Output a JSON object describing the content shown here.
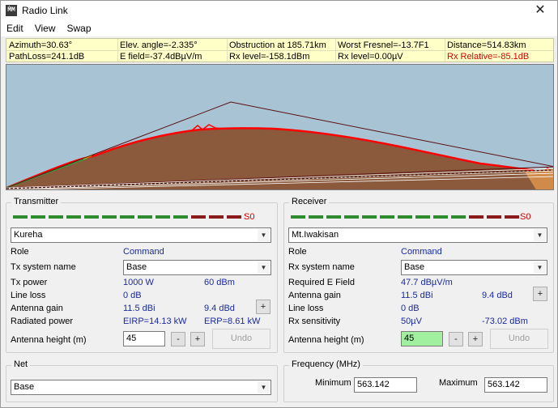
{
  "window": {
    "title": "Radio Link",
    "close_glyph": "✕",
    "icon": "radio-link-app-icon"
  },
  "menu": [
    "Edit",
    "View",
    "Swap"
  ],
  "info": {
    "row1": [
      "Azimuth=30.63°",
      "Elev. angle=-2.335°",
      "Obstruction at 185.71km",
      "Worst Fresnel=-13.7F1",
      "Distance=514.83km"
    ],
    "row2": [
      "PathLoss=241.1dB",
      "E field=-37.4dBµV/m",
      "Rx level=-158.1dBm",
      "Rx level=0.00µV",
      "Rx Relative=-85.1dB"
    ]
  },
  "colors": {
    "sky": "#a8c4d4",
    "terrain": "#8b5a3c",
    "terrain_edge": "#ff0000",
    "ray": "#5a1010",
    "grass": "#3a9a3a",
    "meter_green": "#2e8b2e",
    "meter_red": "#8b1a1a",
    "alert": "#d40000",
    "value_blue": "#1a2aa0"
  },
  "transmitter": {
    "title": "Transmitter",
    "signal": "S0",
    "meter": [
      "g",
      "g",
      "g",
      "g",
      "g",
      "g",
      "g",
      "g",
      "g",
      "g",
      "r",
      "r",
      "r"
    ],
    "site": "Kureha",
    "role_label": "Role",
    "role_value": "Command",
    "sys_label": "Tx system name",
    "sys_value": "Base",
    "power_label": "Tx power",
    "power_w": "1000 W",
    "power_dbm": "60 dBm",
    "loss_label": "Line loss",
    "loss_value": "0 dB",
    "gain_label": "Antenna gain",
    "gain_dbi": "11.5 dBi",
    "gain_dbd": "9.4 dBd",
    "rad_label": "Radiated power",
    "eirp": "EIRP=14.13 kW",
    "erp": "ERP=8.61 kW",
    "height_label": "Antenna height (m)",
    "height_value": "45",
    "minus": "-",
    "plus": "+",
    "undo": "Undo"
  },
  "receiver": {
    "title": "Receiver",
    "signal": "S0",
    "meter": [
      "g",
      "g",
      "g",
      "g",
      "g",
      "g",
      "g",
      "g",
      "g",
      "g",
      "r",
      "r",
      "r"
    ],
    "site": "Mt.Iwakisan",
    "role_label": "Role",
    "role_value": "Command",
    "sys_label": "Rx system name",
    "sys_value": "Base",
    "field_label": "Required E Field",
    "field_value": "47.7 dBµV/m",
    "gain_label": "Antenna gain",
    "gain_dbi": "11.5 dBi",
    "gain_dbd": "9.4 dBd",
    "loss_label": "Line loss",
    "loss_value": "0 dB",
    "sens_label": "Rx sensitivity",
    "sens_uv": "50µV",
    "sens_dbm": "-73.02 dBm",
    "height_label": "Antenna height (m)",
    "height_value": "45",
    "minus": "-",
    "plus": "+",
    "undo": "Undo"
  },
  "net": {
    "title": "Net",
    "value": "Base"
  },
  "frequency": {
    "title": "Frequency (MHz)",
    "min_label": "Minimum",
    "min_value": "563.142",
    "max_label": "Maximum",
    "max_value": "563.142"
  }
}
